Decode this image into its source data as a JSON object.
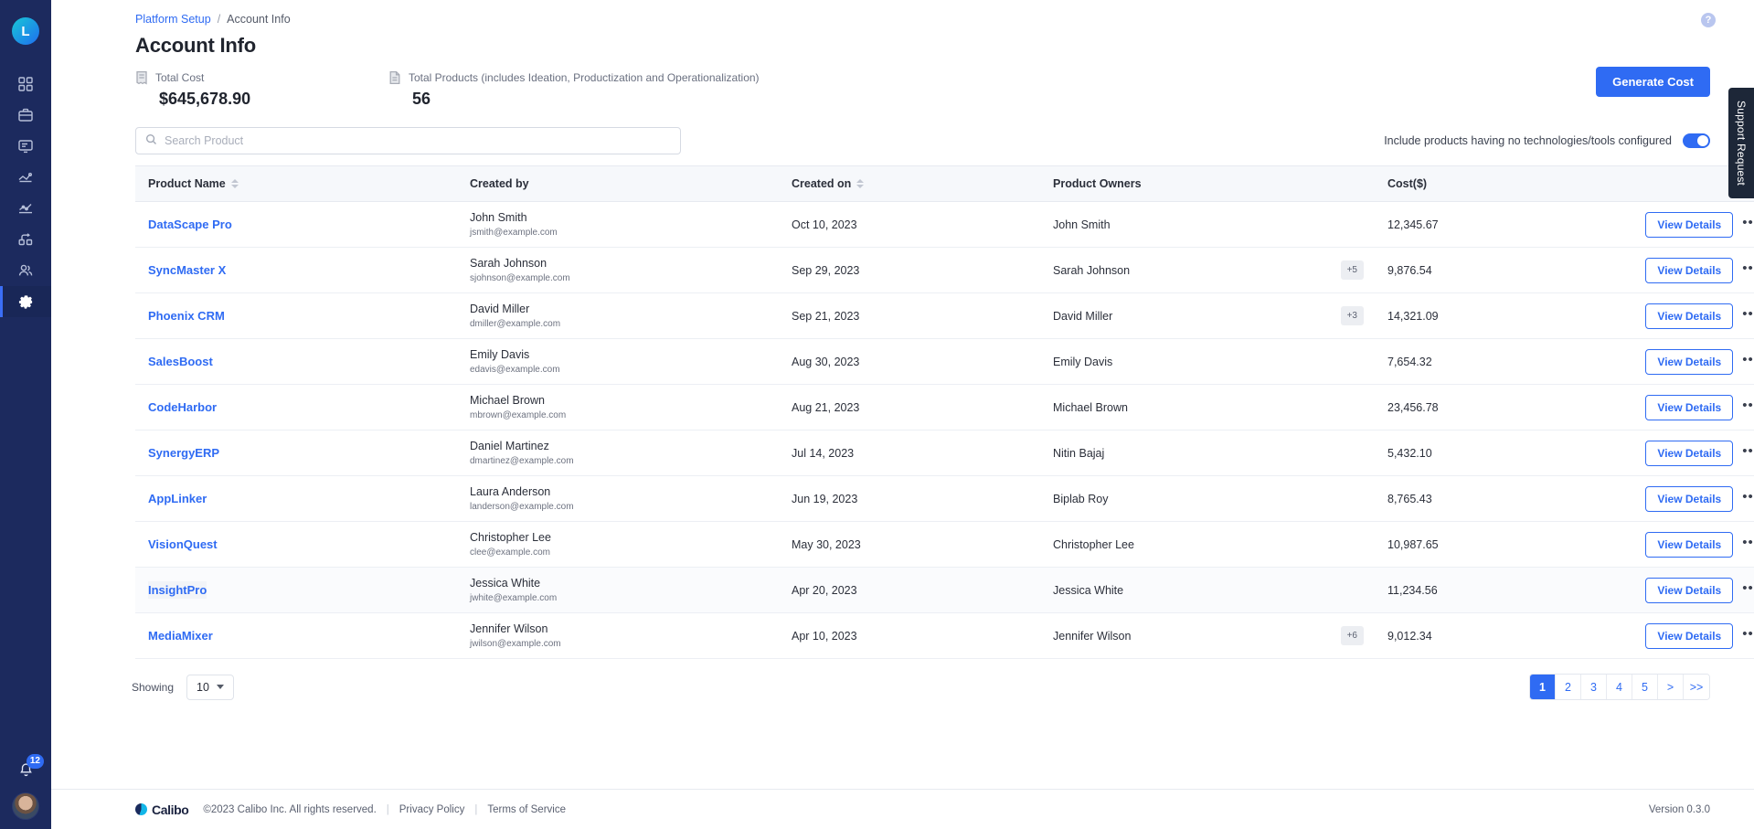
{
  "sidebar": {
    "logo_letter": "L",
    "items": [
      {
        "name": "dashboard",
        "icon": "grid-icon"
      },
      {
        "name": "portfolio",
        "icon": "briefcase-icon"
      },
      {
        "name": "reports",
        "icon": "monitor-icon"
      },
      {
        "name": "pipeline",
        "icon": "flow-icon"
      },
      {
        "name": "analytics",
        "icon": "line-chart-icon"
      },
      {
        "name": "integrations",
        "icon": "nodes-icon"
      },
      {
        "name": "users",
        "icon": "people-icon"
      },
      {
        "name": "settings",
        "icon": "gear-icon"
      }
    ],
    "notifications_count": "12"
  },
  "breadcrumb": {
    "parent": "Platform Setup",
    "separator": "/",
    "current": "Account Info"
  },
  "header": {
    "title": "Account Info",
    "help": "?"
  },
  "stats": [
    {
      "label": "Total Cost",
      "value": "$645,678.90",
      "icon": "receipt-icon"
    },
    {
      "label": "Total Products (includes Ideation, Productization and Operationalization)",
      "value": "56",
      "icon": "document-icon"
    }
  ],
  "actions": {
    "generate_cost": "Generate Cost",
    "support_request": "Support Request"
  },
  "search": {
    "placeholder": "Search Product",
    "value": "",
    "icon": "search-icon"
  },
  "filter_toggle": {
    "label": "Include  products having no technologies/tools configured",
    "enabled": true
  },
  "table": {
    "columns": [
      {
        "label": "Product Name",
        "sortable": true
      },
      {
        "label": "Created by",
        "sortable": false
      },
      {
        "label": "Created on",
        "sortable": true
      },
      {
        "label": "Product Owners",
        "sortable": false
      },
      {
        "label": "Cost($)",
        "sortable": false
      },
      {
        "label": "",
        "sortable": false
      }
    ],
    "view_details_label": "View Details",
    "more_icon": "ellipsis-icon",
    "rows": [
      {
        "product": "DataScape Pro",
        "creator_name": "John Smith",
        "creator_email": "jsmith@example.com",
        "created_on": "Oct 10, 2023",
        "owner": "John Smith",
        "owner_extra": "",
        "cost": "12,345.67",
        "hovered": false
      },
      {
        "product": "SyncMaster X",
        "creator_name": "Sarah Johnson",
        "creator_email": "sjohnson@example.com",
        "created_on": "Sep 29, 2023",
        "owner": "Sarah Johnson",
        "owner_extra": "+5",
        "cost": "9,876.54",
        "hovered": false
      },
      {
        "product": "Phoenix CRM",
        "creator_name": "David Miller",
        "creator_email": "dmiller@example.com",
        "created_on": "Sep 21, 2023",
        "owner": "David Miller",
        "owner_extra": "+3",
        "cost": "14,321.09",
        "hovered": false
      },
      {
        "product": "SalesBoost",
        "creator_name": "Emily Davis",
        "creator_email": "edavis@example.com",
        "created_on": "Aug 30, 2023",
        "owner": "Emily Davis",
        "owner_extra": "",
        "cost": "7,654.32",
        "hovered": false
      },
      {
        "product": "CodeHarbor",
        "creator_name": "Michael Brown",
        "creator_email": "mbrown@example.com",
        "created_on": "Aug 21, 2023",
        "owner": "Michael Brown",
        "owner_extra": "",
        "cost": "23,456.78",
        "hovered": false
      },
      {
        "product": "SynergyERP",
        "creator_name": "Daniel Martinez",
        "creator_email": "dmartinez@example.com",
        "created_on": "Jul 14, 2023",
        "owner": "Nitin Bajaj",
        "owner_extra": "",
        "cost": "5,432.10",
        "hovered": false
      },
      {
        "product": "AppLinker",
        "creator_name": "Laura Anderson",
        "creator_email": "landerson@example.com",
        "created_on": "Jun 19, 2023",
        "owner": "Biplab Roy",
        "owner_extra": "",
        "cost": "8,765.43",
        "hovered": false
      },
      {
        "product": "VisionQuest",
        "creator_name": "Christopher Lee",
        "creator_email": "clee@example.com",
        "created_on": "May 30, 2023",
        "owner": "Christopher Lee",
        "owner_extra": "",
        "cost": "10,987.65",
        "hovered": false
      },
      {
        "product": "InsightPro",
        "creator_name": "Jessica White",
        "creator_email": "jwhite@example.com",
        "created_on": "Apr 20, 2023",
        "owner": "Jessica White",
        "owner_extra": "",
        "cost": "11,234.56",
        "hovered": true
      },
      {
        "product": "MediaMixer",
        "creator_name": "Jennifer Wilson",
        "creator_email": "jwilson@example.com",
        "created_on": "Apr 10, 2023",
        "owner": "Jennifer Wilson",
        "owner_extra": "+6",
        "cost": "9,012.34",
        "hovered": false
      }
    ]
  },
  "pagination": {
    "showing_label": "Showing",
    "page_size": "10",
    "pages": [
      "1",
      "2",
      "3",
      "4",
      "5",
      ">",
      ">>"
    ],
    "active_page": "1"
  },
  "footer": {
    "brand": "Calibo",
    "copyright": "©2023 Calibo Inc. All rights reserved.",
    "privacy": "Privacy Policy",
    "terms": "Terms of Service",
    "version": "Version 0.3.0"
  },
  "colors": {
    "accent": "#2f6bf3",
    "sidebar": "#1c2a5e",
    "header_bg": "#f6f8fb"
  }
}
